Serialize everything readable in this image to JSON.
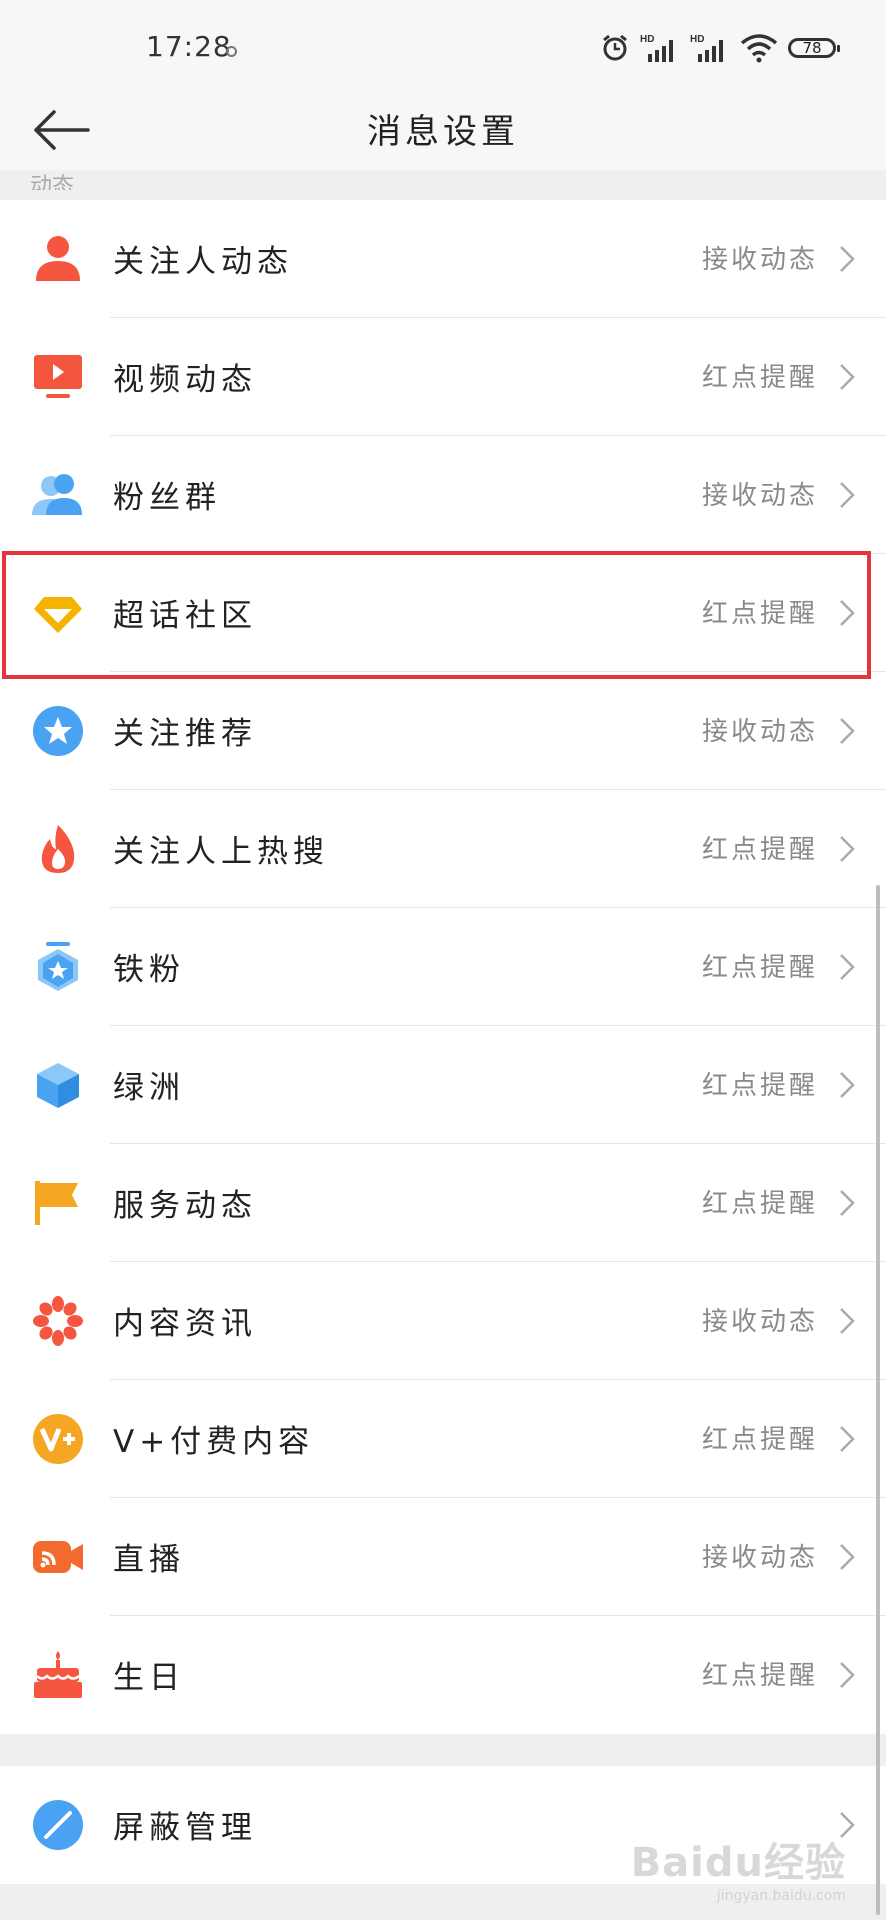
{
  "status_bar": {
    "time": "17:28",
    "battery": "78",
    "signal_label_1": "HD",
    "signal_label_2": "HD"
  },
  "nav": {
    "title": "消息设置"
  },
  "section": {
    "label": "动态"
  },
  "items": [
    {
      "label": "关注人动态",
      "value": "接收动态",
      "icon": "person-icon",
      "color": "#f4563f"
    },
    {
      "label": "视频动态",
      "value": "红点提醒",
      "icon": "video-screen-icon",
      "color": "#f4563f"
    },
    {
      "label": "粉丝群",
      "value": "接收动态",
      "icon": "group-icon",
      "color": "#4aa3f2"
    },
    {
      "label": "超话社区",
      "value": "红点提醒",
      "icon": "diamond-icon",
      "color": "#f5b300"
    },
    {
      "label": "关注推荐",
      "value": "接收动态",
      "icon": "star-plus-icon",
      "color": "#4aa3f2"
    },
    {
      "label": "关注人上热搜",
      "value": "红点提醒",
      "icon": "flame-icon",
      "color": "#f4563f"
    },
    {
      "label": "铁粉",
      "value": "红点提醒",
      "icon": "iron-fan-badge-icon",
      "color": "#4aa3f2"
    },
    {
      "label": "绿洲",
      "value": "红点提醒",
      "icon": "cube-icon",
      "color": "#4aa3f2"
    },
    {
      "label": "服务动态",
      "value": "红点提醒",
      "icon": "flag-icon",
      "color": "#f5a623"
    },
    {
      "label": "内容资讯",
      "value": "接收动态",
      "icon": "flower-icon",
      "color": "#f4563f"
    },
    {
      "label": "V+付费内容",
      "value": "红点提醒",
      "icon": "vplus-icon",
      "color": "#f5a623"
    },
    {
      "label": "直播",
      "value": "接收动态",
      "icon": "live-camera-icon",
      "color": "#f26a2e"
    },
    {
      "label": "生日",
      "value": "红点提醒",
      "icon": "cake-icon",
      "color": "#f4563f"
    }
  ],
  "bottom_item": {
    "label": "屏蔽管理",
    "icon": "block-icon",
    "color": "#4aa3f2"
  },
  "watermark": {
    "text": "Baidu经验",
    "sub": "jingyan.baidu.com"
  },
  "accent": {
    "highlight": "#e3353b"
  }
}
